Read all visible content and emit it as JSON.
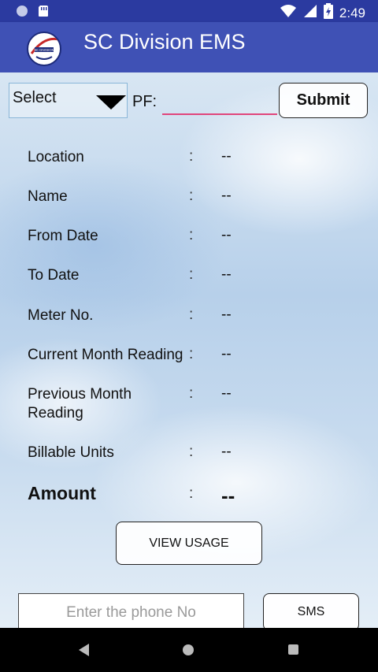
{
  "status_bar": {
    "time": "2:49"
  },
  "app_bar": {
    "title": "SC Division EMS",
    "logo_text": "SC DIVISION"
  },
  "search": {
    "select_label": "Select",
    "pf_label": "PF:",
    "pf_value": "",
    "submit_label": "Submit"
  },
  "fields": [
    {
      "label": "Location",
      "colon": ":",
      "value": "--"
    },
    {
      "label": "Name",
      "colon": ":",
      "value": "--"
    },
    {
      "label": "From Date",
      "colon": ":",
      "value": "--"
    },
    {
      "label": "To Date",
      "colon": ":",
      "value": "--"
    },
    {
      "label": "Meter No.",
      "colon": ":",
      "value": "--"
    },
    {
      "label": "Current Month Reading",
      "colon": ":",
      "value": "--"
    },
    {
      "label": "Previous Month Reading",
      "colon": ":",
      "value": "--"
    },
    {
      "label": "Billable Units",
      "colon": ":",
      "value": "--"
    }
  ],
  "amount": {
    "label": "Amount",
    "colon": ":",
    "value": "--"
  },
  "actions": {
    "view_usage_label": "VIEW USAGE",
    "phone_placeholder": "Enter the phone No",
    "sms_label": "SMS"
  },
  "colors": {
    "status_bar": "#2b3aa0",
    "app_bar": "#3f51b5",
    "pf_underline": "#e0457b"
  },
  "icons": [
    "circle-icon",
    "sd-card-icon",
    "wifi-icon",
    "signal-icon",
    "battery-icon",
    "back-icon",
    "home-icon",
    "recents-icon"
  ]
}
